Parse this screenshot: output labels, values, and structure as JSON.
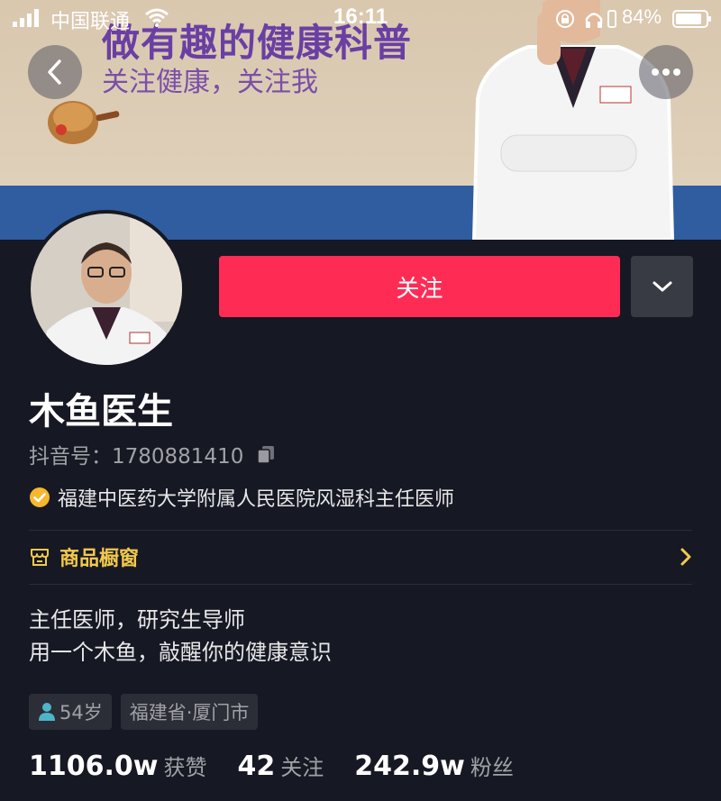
{
  "status_bar": {
    "carrier": "中国联通",
    "time": "16:11",
    "battery": "84%"
  },
  "banner": {
    "title": "做有趣的健康科普",
    "subtitle": "关注健康，关注我",
    "colors": {
      "title": "#6a3fa4",
      "band": "#2f5d9f"
    }
  },
  "header": {
    "back_icon": "chevron-left-icon",
    "more_icon": "ellipsis-icon"
  },
  "profile": {
    "follow_label": "关注",
    "dropdown_icon": "chevron-down-icon",
    "name": "木鱼医生",
    "uid": "抖音号：1780881410",
    "certification": "福建中医药大学附属人民医院风湿科主任医师",
    "shop_label": "商品橱窗",
    "bio_lines": [
      "主任医师，研究生导师",
      "用一个木鱼，敲醒你的健康意识"
    ],
    "tags": {
      "age": "54岁",
      "location": "福建省·厦门市"
    },
    "stats": [
      {
        "value": "1106.0w",
        "label": "获赞"
      },
      {
        "value": "42",
        "label": "关注"
      },
      {
        "value": "242.9w",
        "label": "粉丝"
      }
    ]
  },
  "colors": {
    "accent": "#fe2c55",
    "background": "#161823",
    "shop": "#f2c94c",
    "verified": "#f5b82e"
  }
}
